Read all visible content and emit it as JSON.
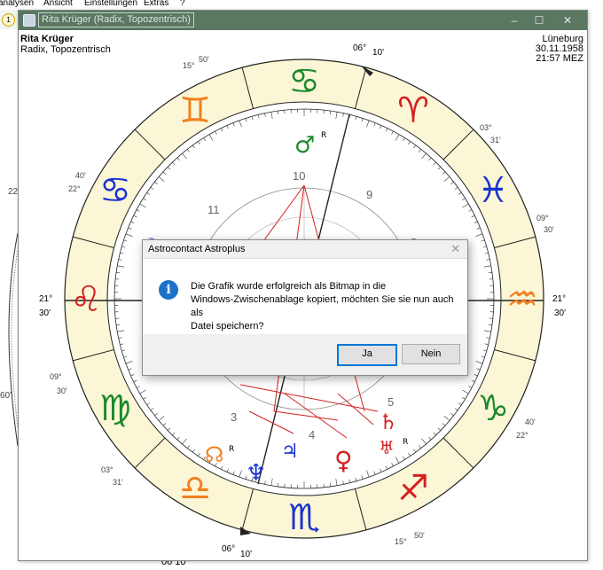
{
  "menubar": {
    "items": [
      "analysen",
      "Ansicht",
      "Einstellungen",
      "Extras",
      "?"
    ]
  },
  "toolbar": {
    "button_label": "1"
  },
  "background": {
    "left_labels": [
      "22",
      "60'"
    ],
    "bottom_label": "06 10'"
  },
  "window": {
    "title": "Rita Krüger (Radix, Topozentrisch)",
    "controls": [
      "–",
      "☐",
      "✕"
    ]
  },
  "chart_header": {
    "name": "Rita Krüger",
    "type": "Radix, Topozentrisch",
    "place": "Lüneburg",
    "date": "30.11.1958",
    "time": "21:57 MEZ"
  },
  "zodiac": {
    "signs": [
      {
        "glyph": "♋",
        "name": "cancer",
        "color": "#1a8a2a",
        "rotate": -90
      },
      {
        "glyph": "♈",
        "name": "aries",
        "color": "#d42020",
        "rotate": -60
      },
      {
        "glyph": "♓",
        "name": "pisces",
        "color": "#1a34d0",
        "rotate": -30
      },
      {
        "glyph": "♒",
        "name": "aquarius",
        "color": "#f08020",
        "rotate": 0
      },
      {
        "glyph": "♑",
        "name": "capricorn",
        "color": "#1a8a2a",
        "rotate": 30
      },
      {
        "glyph": "♐",
        "name": "sagittarius",
        "color": "#d42020",
        "rotate": 60
      },
      {
        "glyph": "♏",
        "name": "scorpio",
        "color": "#1a34d0",
        "rotate": 90
      },
      {
        "glyph": "♎",
        "name": "libra",
        "color": "#f08020",
        "rotate": 120
      },
      {
        "glyph": "♍",
        "name": "virgo",
        "color": "#1a8a2a",
        "rotate": 150
      },
      {
        "glyph": "♌",
        "name": "leo",
        "color": "#d42020",
        "rotate": 180
      },
      {
        "glyph": "♋",
        "name": "cancer-2",
        "color": "#1a34d0",
        "rotate": 210
      },
      {
        "glyph": "♊",
        "name": "gemini",
        "color": "#f08020",
        "rotate": 240
      }
    ],
    "ring_fill": "#fbf6d6"
  },
  "house_numbers": [
    "10",
    "9",
    "11",
    "8",
    "3",
    "4",
    "5"
  ],
  "cusp_labels": [
    {
      "deg": "06°",
      "min": "10'"
    },
    {
      "deg": "15°",
      "min": "50'"
    },
    {
      "deg": "03°",
      "min": "31'"
    },
    {
      "deg": "40'",
      "min": "22°"
    },
    {
      "deg": "09°",
      "min": "30'"
    },
    {
      "deg": "21°",
      "min": "30'"
    },
    {
      "deg": "21°",
      "min": "30'"
    },
    {
      "deg": "09°",
      "min": "30'"
    },
    {
      "deg": "40'",
      "min": "22°"
    },
    {
      "deg": "03°",
      "min": "31'"
    },
    {
      "deg": "15°",
      "min": "50'"
    },
    {
      "deg": "06°",
      "min": "10'"
    }
  ],
  "planets": [
    {
      "glyph": "♂",
      "name": "mars",
      "color": "#1a8a2a",
      "retro": "R"
    },
    {
      "glyph": "☊",
      "name": "node",
      "color": "#f08020",
      "retro": "R"
    },
    {
      "glyph": "♆",
      "name": "neptune",
      "color": "#1a34d0",
      "retro": ""
    },
    {
      "glyph": "♃",
      "name": "jupiter",
      "color": "#1a34d0",
      "retro": ""
    },
    {
      "glyph": "♀",
      "name": "venus",
      "color": "#d42020",
      "retro": ""
    },
    {
      "glyph": "♄",
      "name": "saturn",
      "color": "#d42020",
      "retro": ""
    },
    {
      "glyph": "♅",
      "name": "uranus",
      "color": "#d42020",
      "retro": "R"
    },
    {
      "glyph": "☽",
      "name": "moon",
      "color": "#1a34d0",
      "retro": ""
    }
  ],
  "dialog": {
    "title": "Astrocontact Astroplus",
    "close": "✕",
    "icon": "i",
    "message_line1": "Die Grafik wurde erfolgreich als Bitmap in die",
    "message_line2": "Windows-Zwischenablage kopiert, möchten Sie sie nun auch als",
    "message_line3": "Datei speichern?",
    "yes_label": "Ja",
    "no_label": "Nein"
  },
  "colors": {
    "titlebar": "#5a7762",
    "accent": "#0078d7",
    "aspect_red": "#d42020"
  }
}
